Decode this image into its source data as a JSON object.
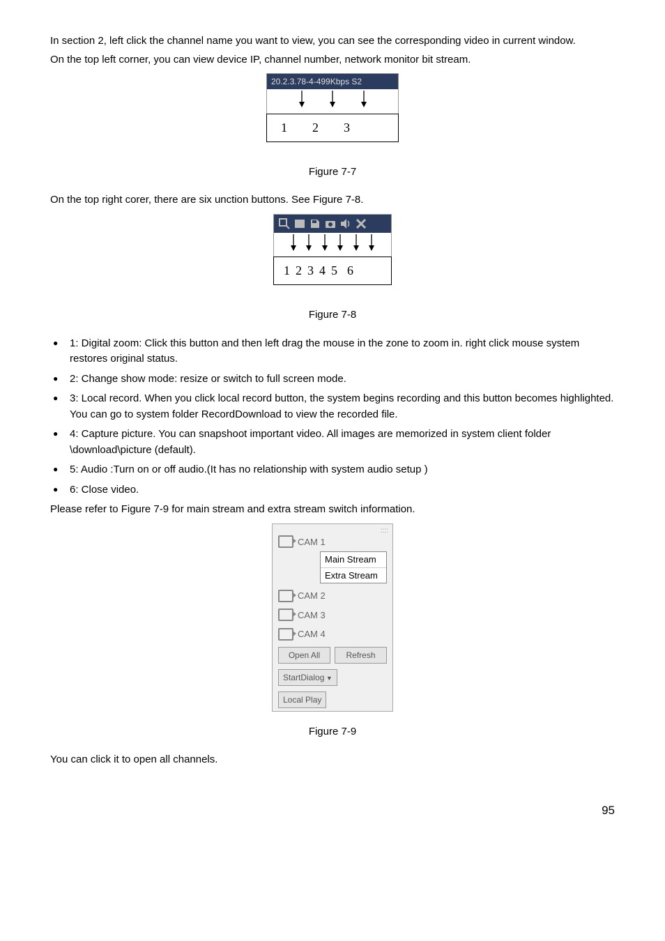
{
  "para1": " In section 2, left click the channel name you want to view, you can see the corresponding video in current window.",
  "para2": "On the top left corner, you can view device IP, channel number, network monitor bit stream.",
  "fig77": {
    "header": "20.2.3.78-4-499Kbps S2",
    "nums": [
      "1",
      "2",
      "3"
    ],
    "label": "Figure 7-7"
  },
  "para3": "On the top right corer, there are six unction buttons. See Figure 7-8.",
  "fig78": {
    "nums": [
      "1",
      "2",
      "3",
      "4",
      "5",
      "6"
    ],
    "label": "Figure 7-8"
  },
  "bullets": [
    "1: Digital zoom: Click this button and then left drag the mouse in the zone to zoom in. right click mouse system restores original status.",
    "2: Change show mode: resize or switch to full screen mode.",
    "3: Local record. When you click local record button, the system begins recording and this button becomes highlighted. You can go to system folder RecordDownload to view the recorded file.",
    "4: Capture picture. You can snapshoot important video. All images are memorized in system client folder \\download\\picture (default).",
    "5: Audio :Turn on or off audio.(It has no relationship with system audio setup )",
    "6: Close video."
  ],
  "para4": "Please refer to Figure 7-9 for main stream and extra stream switch information.",
  "panel": {
    "cam1": "CAM 1",
    "main_stream": "Main Stream",
    "extra_stream": "Extra Stream",
    "cam2": "CAM 2",
    "cam3": "CAM 3",
    "cam4": "CAM 4",
    "open_all": "Open All",
    "refresh": "Refresh",
    "start_dialog": "StartDialog",
    "local_play": "Local Play"
  },
  "fig79_label": "Figure 7-9",
  "para5": "You can click it to open all channels.",
  "pagenum": "95"
}
